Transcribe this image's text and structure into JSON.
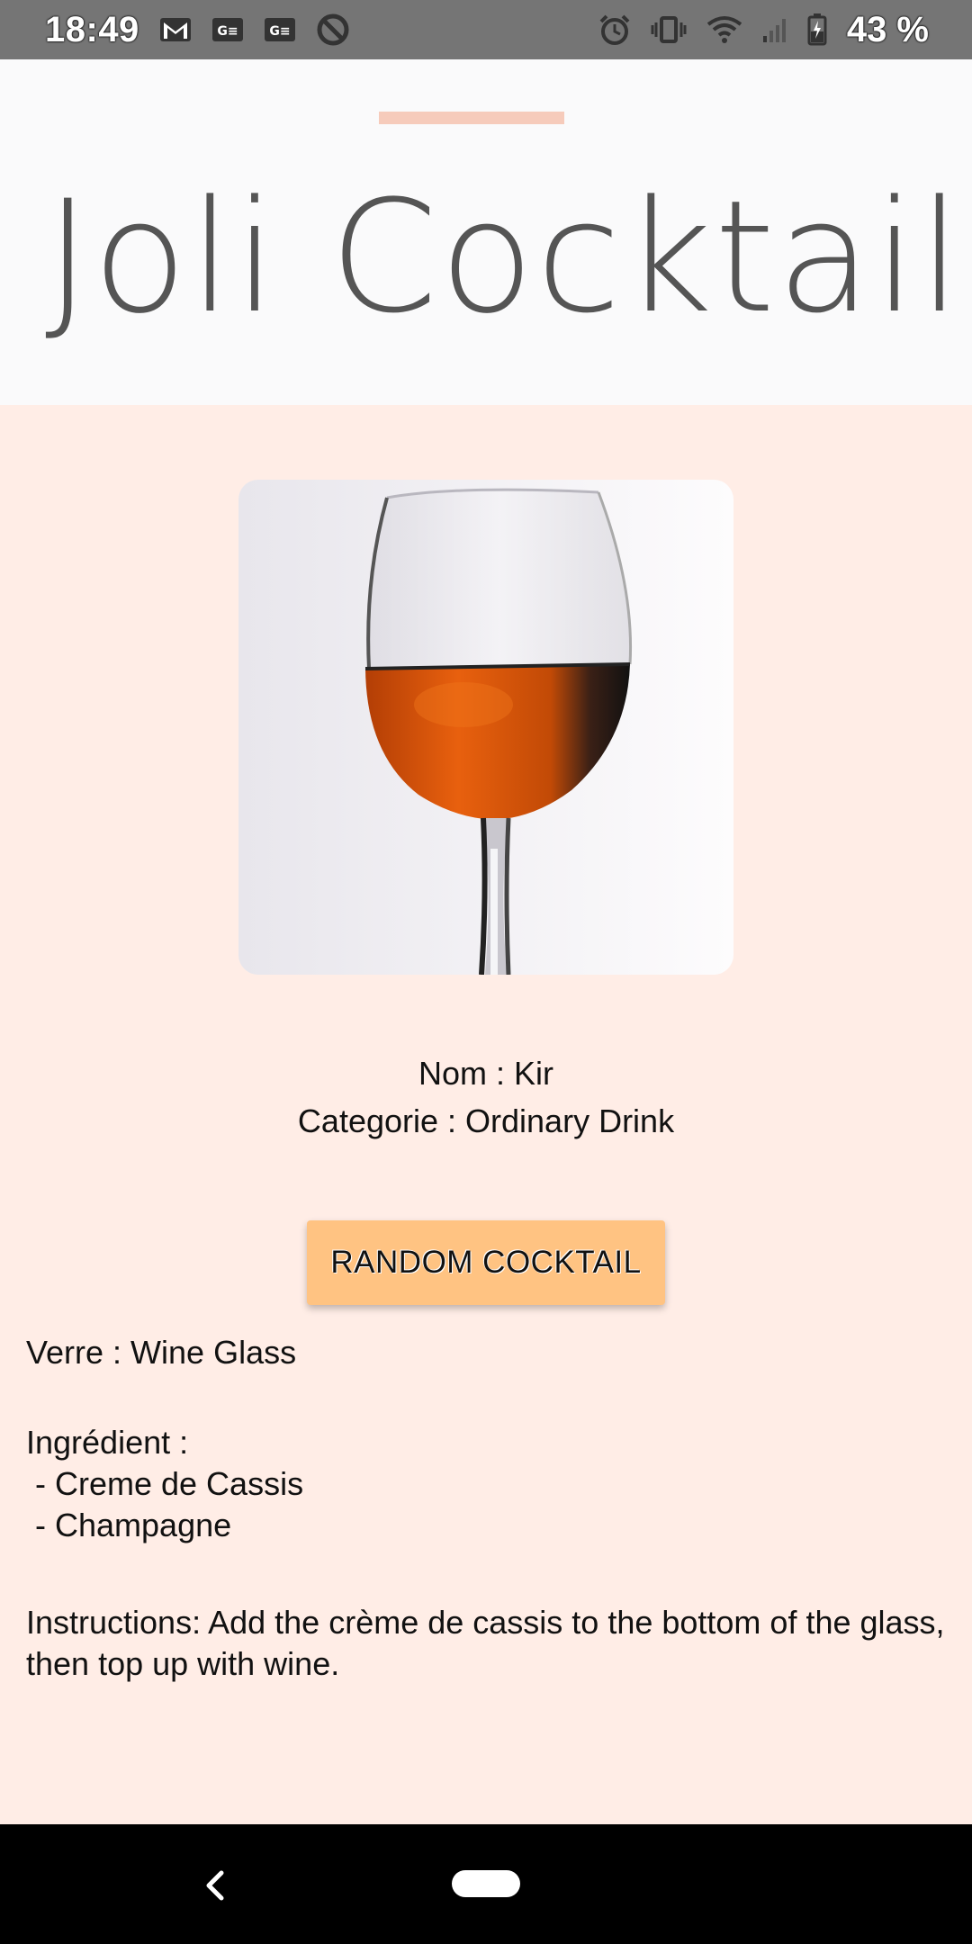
{
  "status_bar": {
    "time": "18:49",
    "left_icons": [
      "gmail-icon",
      "news-icon",
      "news-icon",
      "blocked-icon"
    ],
    "right_icons": [
      "alarm-icon",
      "vibrate-icon",
      "wifi-icon",
      "signal-icon",
      "battery-charging-icon"
    ],
    "battery_level": "43 %"
  },
  "header": {
    "title": "Joli Cocktail",
    "accent_color": "#f6cbbb"
  },
  "cocktail": {
    "name_line": "Nom : Kir",
    "category_line": "Categorie : Ordinary Drink",
    "glass_line": "Verre : Wine Glass",
    "ingredients_heading": "Ingrédient :",
    "ingredients": [
      " - Creme de Cassis",
      " - Champagne"
    ],
    "instructions": "Instructions: Add the crème de cassis to the bottom of the glass, then top up with wine."
  },
  "actions": {
    "random_label": "RANDOM COCKTAIL",
    "button_color": "#ffc382"
  },
  "colors": {
    "content_background": "#ffede6",
    "header_background": "#fafafb",
    "status_bar": "#757575"
  },
  "nav_bar": {
    "icons": [
      "back-icon",
      "home-pill-icon"
    ]
  }
}
